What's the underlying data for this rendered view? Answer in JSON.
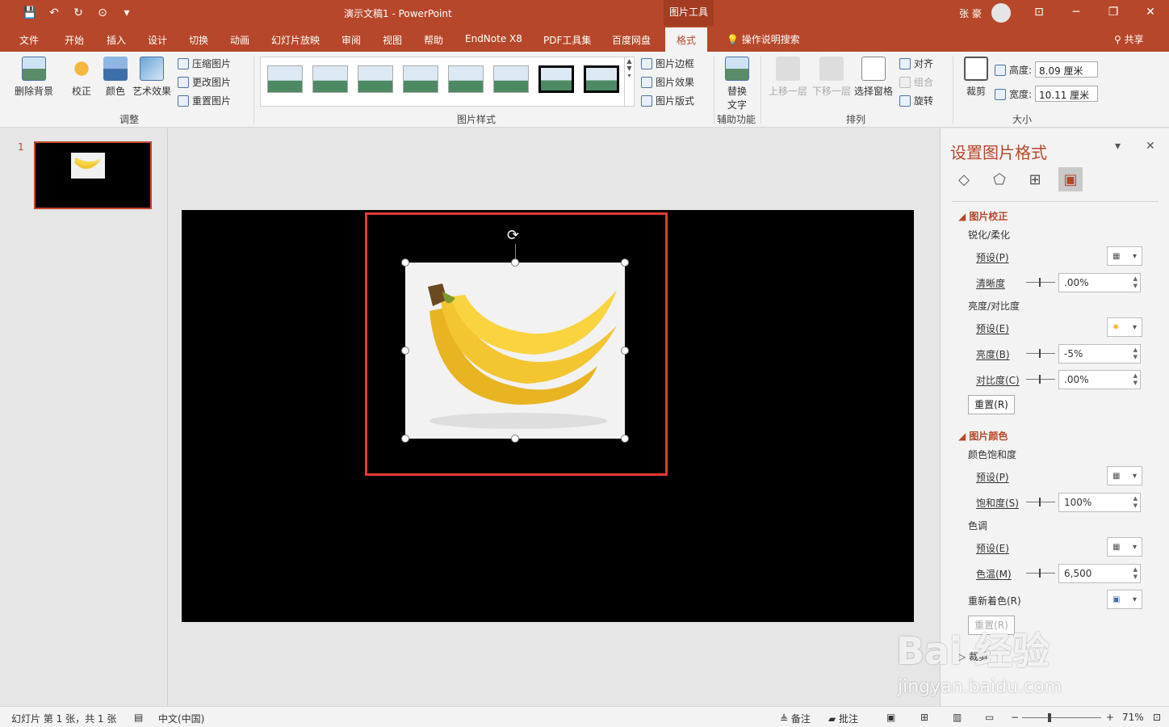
{
  "qat": {
    "save": "💾",
    "undo": "↶",
    "redo": "↻",
    "present": "⊙",
    "customize": "▾"
  },
  "title": {
    "doc": "演示文稿1  -  PowerPoint",
    "tools": "图片工具",
    "user": "张 豪"
  },
  "window": {
    "ribbon_opts": "⊡",
    "minimize": "─",
    "restore": "❐",
    "close": "✕"
  },
  "tabs": [
    "文件",
    "开始",
    "插入",
    "设计",
    "切换",
    "动画",
    "幻灯片放映",
    "审阅",
    "视图",
    "帮助",
    "EndNote X8",
    "PDF工具集",
    "百度网盘",
    "格式"
  ],
  "search": "操作说明搜索",
  "share": "共享",
  "ribbon": {
    "adjust": {
      "remove_bg": "删除背景",
      "correct": "校正",
      "color": "颜色",
      "art": "艺术效果",
      "compress": "压缩图片",
      "change": "更改图片",
      "reset": "重置图片",
      "label": "调整"
    },
    "styles": {
      "border": "图片边框",
      "effects": "图片效果",
      "layout": "图片版式",
      "label": "图片样式"
    },
    "access": {
      "alt_text": "替换",
      "alt_text2": "文字",
      "label": "辅助功能"
    },
    "arrange": {
      "forward": "上移一层",
      "backward": "下移一层",
      "pane": "选择窗格",
      "align": "对齐",
      "group": "组合",
      "rotate": "旋转",
      "label": "排列"
    },
    "size": {
      "crop": "裁剪",
      "height_label": "高度:",
      "height": "8.09 厘米",
      "width_label": "宽度:",
      "width": "10.11 厘米",
      "label": "大小"
    }
  },
  "slides": {
    "number": "1"
  },
  "pane": {
    "title": "设置图片格式",
    "correction": {
      "title": "图片校正",
      "sharpen_soften": "锐化/柔化",
      "preset1": "预设(P)",
      "sharpness": "清晰度",
      "sharpness_val": ".00%",
      "brightness_contrast": "亮度/对比度",
      "preset2": "预设(E)",
      "brightness": "亮度(B)",
      "brightness_val": "-5%",
      "contrast": "对比度(C)",
      "contrast_val": ".00%",
      "reset": "重置(R)"
    },
    "color": {
      "title": "图片颜色",
      "saturation_group": "颜色饱和度",
      "preset1": "预设(P)",
      "saturation": "饱和度(S)",
      "saturation_val": "100%",
      "tone_group": "色调",
      "preset2": "预设(E)",
      "temperature": "色温(M)",
      "temperature_val": "6,500",
      "recolor": "重新着色(R)",
      "reset": "重置(R)"
    },
    "crop_section": "裁剪"
  },
  "status": {
    "slide_info": "幻灯片 第 1 张，共 1 张",
    "language": "中文(中国)",
    "notes": "备注",
    "comments": "批注",
    "zoom": "71%"
  },
  "watermark": {
    "main": "Bai 经验",
    "url": "jingyan.baidu.com"
  },
  "colors": {
    "accent": "#b7472a",
    "selection": "#e53935",
    "slide_bg": "#000000"
  }
}
